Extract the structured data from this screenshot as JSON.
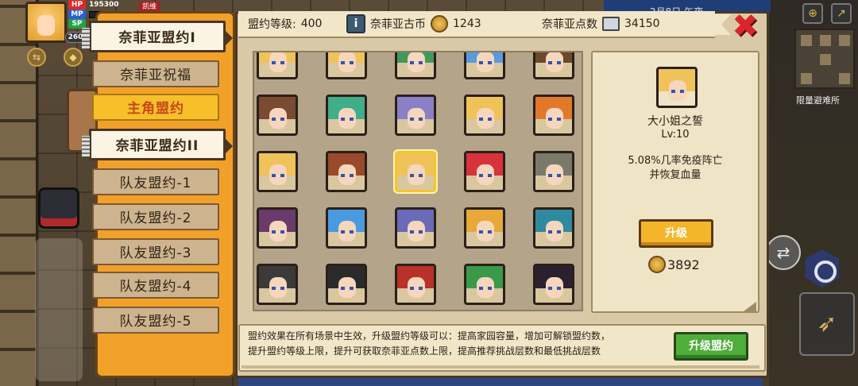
{
  "hud": {
    "hp_label": "HP",
    "mp_label": "MP",
    "sp_label": "SP",
    "hp_value": "195300",
    "level": "260",
    "red_label": "凯维",
    "minimap_label": "限量避难所",
    "time_text": "2月8日 午夜"
  },
  "topbar": {
    "league_level_label": "盟约等级:",
    "league_level_value": "400",
    "coin_label": "奈菲亚古币",
    "coin_value": "1243",
    "points_label": "奈菲亚点数",
    "points_value": "34150"
  },
  "sidebar": {
    "tabs": [
      {
        "label": "奈菲亚盟约I"
      },
      {
        "label": "奈菲亚祝福"
      },
      {
        "label": "主角盟约"
      },
      {
        "label": "奈菲亚盟约II"
      },
      {
        "label": "队友盟约-1"
      },
      {
        "label": "队友盟约-2"
      },
      {
        "label": "队友盟约-3"
      },
      {
        "label": "队友盟约-4"
      },
      {
        "label": "队友盟约-5"
      }
    ]
  },
  "detail": {
    "name": "大小姐之誓",
    "level": "Lv:10",
    "desc_line1": "5.08%几率免疫阵亡",
    "desc_line2": "并恢复血量",
    "upgrade_label": "升级",
    "cost": "3892"
  },
  "bottom": {
    "line1": "盟约效果在所有场景中生效，升级盟约等级可以：提高家园容量，增加可解锁盟约数，",
    "line2": "提升盟约等级上限，提升可获取奈菲亚点数上限，提高推荐挑战层数和最低挑战层数",
    "level_up_label": "升级盟约"
  },
  "portraits": [
    {
      "hair": "#f0c25a"
    },
    {
      "hair": "#f0c25a"
    },
    {
      "hair": "#3e9a5a"
    },
    {
      "hair": "#5a9ae0"
    },
    {
      "hair": "#6a4a2a"
    },
    {
      "hair": "#7a4a32"
    },
    {
      "hair": "#3fae8a"
    },
    {
      "hair": "#8a80c8"
    },
    {
      "hair": "#f0c25a"
    },
    {
      "hair": "#e07a2a"
    },
    {
      "hair": "#f0c25a"
    },
    {
      "hair": "#9a4a2a"
    },
    {
      "hair": "#f0c25a"
    },
    {
      "hair": "#d8323a"
    },
    {
      "hair": "#7a7a6a"
    },
    {
      "hair": "#6a3a6a"
    },
    {
      "hair": "#4a9ae0"
    },
    {
      "hair": "#6a6ab8"
    },
    {
      "hair": "#e8a83a"
    },
    {
      "hair": "#2f8aa0"
    },
    {
      "hair": "#3a3a3a"
    },
    {
      "hair": "#2a2a2a"
    },
    {
      "hair": "#b8322a"
    },
    {
      "hair": "#3a9a4a"
    },
    {
      "hair": "#2a2030"
    }
  ],
  "selected_portrait": 12
}
